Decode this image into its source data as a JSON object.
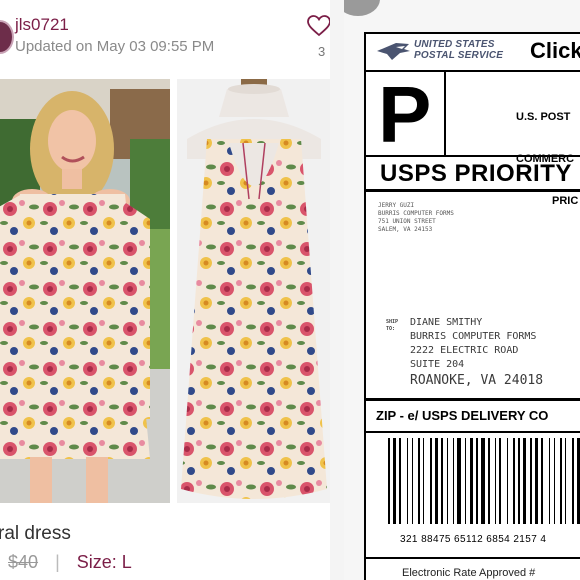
{
  "listing": {
    "username": "jls0721",
    "updated": "Updated on May 03 09:55 PM",
    "like_count": "3",
    "title": "ral dress",
    "price": "$40",
    "price_separator": "|",
    "size": "Size: L",
    "colors": {
      "accent": "#7b1e47",
      "muted": "#8a8a8a"
    }
  },
  "label": {
    "carrier_line_1": "UNITED STATES",
    "carrier_line_2": "POSTAL SERVICE",
    "click_text": "Click",
    "service_letter": "P",
    "postage_line_1": "U.S. POST",
    "postage_line_2": "COMMERC",
    "postage_line_3": "PRIC",
    "service_name": "USPS PRIORITY",
    "from": [
      "JERRY GUZI",
      "BURRIS COMPUTER FORMS",
      "751 UNION STREET",
      "SALEM, VA 24153"
    ],
    "ship_to_tag": [
      "SHIP",
      "TO:"
    ],
    "to": [
      "DIANE SMITHY",
      "BURRIS COMPUTER FORMS",
      "2222 ELECTRIC ROAD",
      "SUITE 204",
      "ROANOKE, VA 24018"
    ],
    "zip_header": "ZIP - e/ USPS DELIVERY CO",
    "tracking": "321 88475 65112 6854 2157 4",
    "bottom": "Electronic Rate Approved #"
  }
}
